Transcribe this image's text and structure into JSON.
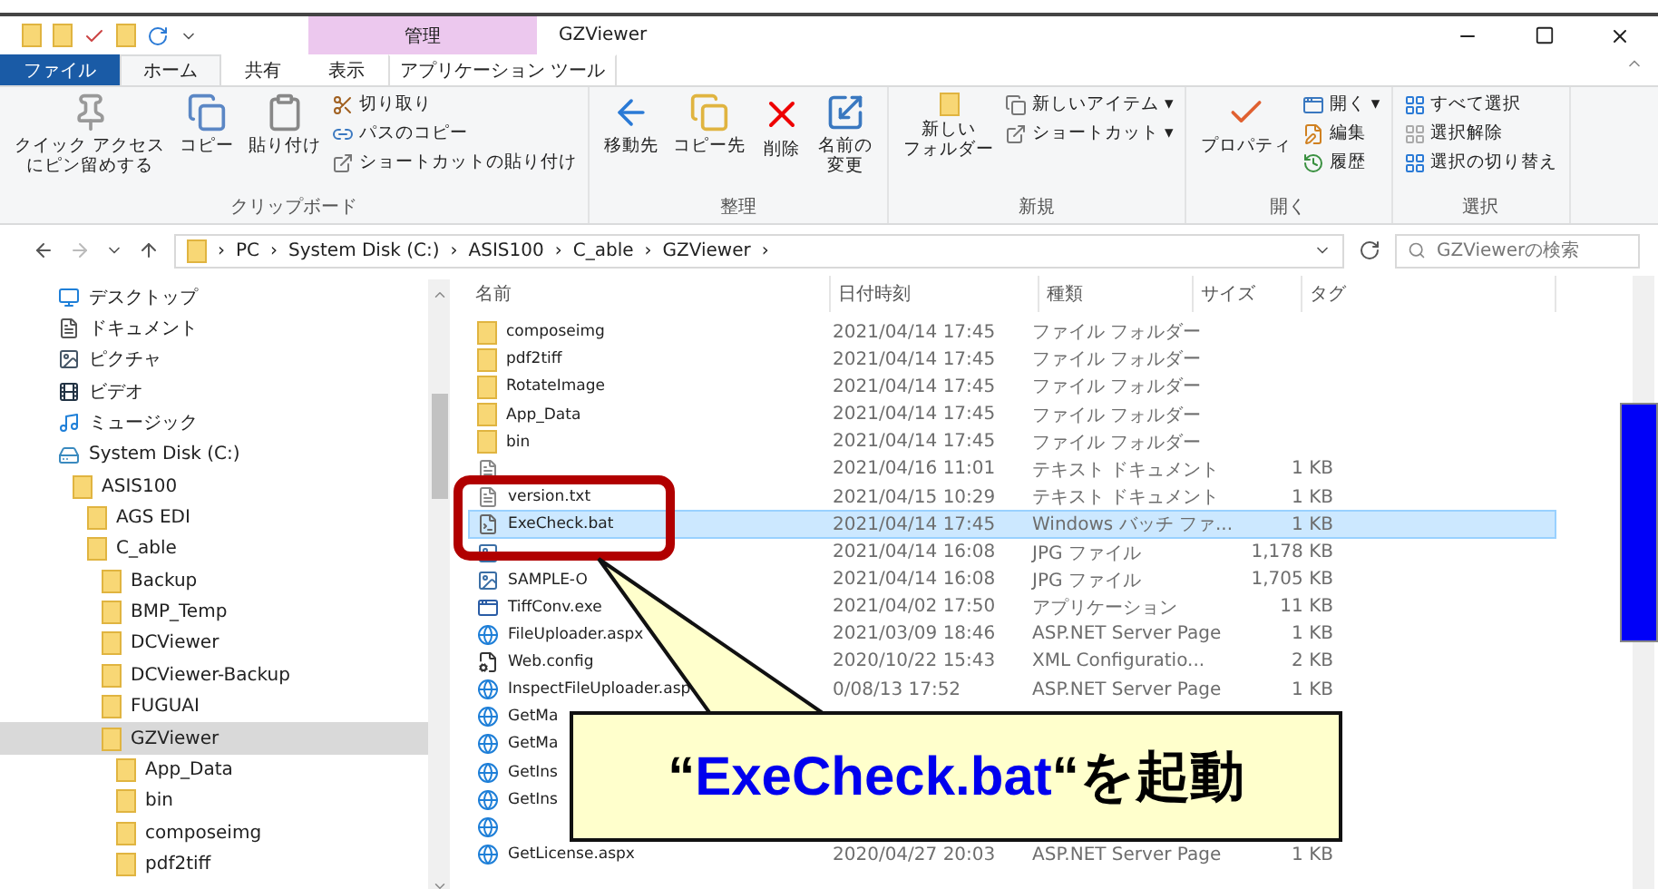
{
  "window": {
    "title": "GZViewer",
    "context_tab": "管理"
  },
  "ribbon_tabs": [
    {
      "label": "ファイル",
      "kind": "file",
      "selected": false
    },
    {
      "label": "ホーム",
      "kind": "tab",
      "selected": true
    },
    {
      "label": "共有",
      "kind": "tab",
      "selected": false
    },
    {
      "label": "表示",
      "kind": "tab",
      "selected": false
    },
    {
      "label": "アプリケーション ツール",
      "kind": "context",
      "selected": false
    }
  ],
  "ribbon_groups": [
    {
      "label": "クリップボード",
      "large": [
        [
          "クイック アクセス",
          "にピン留めする"
        ],
        [
          "コピー"
        ],
        [
          "貼り付け"
        ]
      ],
      "small": [
        "切り取り",
        "パスのコピー",
        "ショートカットの貼り付け"
      ]
    },
    {
      "label": "整理",
      "large": [
        [
          "移動先"
        ],
        [
          "コピー先"
        ],
        [
          "削除"
        ],
        [
          "名前の",
          "変更"
        ]
      ]
    },
    {
      "label": "新規",
      "large": [
        [
          "新しい",
          "フォルダー"
        ]
      ],
      "small": [
        "新しいアイテム ▾",
        "ショートカット ▾"
      ]
    },
    {
      "label": "開く",
      "large": [
        [
          "プロパティ"
        ]
      ],
      "small": [
        "開く ▾",
        "編集",
        "履歴"
      ]
    },
    {
      "label": "選択",
      "small": [
        "すべて選択",
        "選択解除",
        "選択の切り替え"
      ]
    }
  ],
  "address": {
    "separator": "›",
    "crumbs": [
      "PC",
      "System Disk (C:)",
      "ASIS100",
      "C_able",
      "GZViewer"
    ],
    "search_placeholder": "GZViewerの検索"
  },
  "nav_tree": [
    {
      "label": "デスクトップ",
      "kind": "desktop",
      "selected": false
    },
    {
      "label": "ドキュメント",
      "kind": "document",
      "selected": false
    },
    {
      "label": "ピクチャ",
      "kind": "picture",
      "selected": false
    },
    {
      "label": "ビデオ",
      "kind": "video",
      "selected": false
    },
    {
      "label": "ミュージック",
      "kind": "music",
      "selected": false
    },
    {
      "label": "System Disk (C:)",
      "kind": "disk",
      "selected": false,
      "children": [
        {
          "label": "ASIS100",
          "kind": "folder",
          "selected": false,
          "children": [
            {
              "label": "AGS EDI",
              "kind": "folder",
              "selected": false
            },
            {
              "label": "C_able",
              "kind": "folder",
              "selected": false,
              "children": [
                {
                  "label": "Backup",
                  "kind": "folder",
                  "selected": false
                },
                {
                  "label": "BMP_Temp",
                  "kind": "folder",
                  "selected": false
                },
                {
                  "label": "DCViewer",
                  "kind": "folder",
                  "selected": false
                },
                {
                  "label": "DCViewer-Backup",
                  "kind": "folder",
                  "selected": false
                },
                {
                  "label": "FUGUAI",
                  "kind": "folder",
                  "selected": false
                },
                {
                  "label": "GZViewer",
                  "kind": "folder",
                  "selected": true,
                  "children": [
                    {
                      "label": "App_Data",
                      "kind": "folder",
                      "selected": false
                    },
                    {
                      "label": "bin",
                      "kind": "folder",
                      "selected": false
                    },
                    {
                      "label": "composeimg",
                      "kind": "folder",
                      "selected": false
                    },
                    {
                      "label": "pdf2tiff",
                      "kind": "folder",
                      "selected": false
                    }
                  ]
                }
              ]
            }
          ]
        }
      ]
    }
  ],
  "columns": [
    "名前",
    "日付時刻",
    "種類",
    "サイズ",
    "タグ"
  ],
  "files": [
    {
      "kind": "folder",
      "name": "composeimg",
      "date": "2021/04/14 17:45",
      "type": "ファイル フォルダー",
      "selected": false
    },
    {
      "kind": "folder",
      "name": "pdf2tiff",
      "date": "2021/04/14 17:45",
      "type": "ファイル フォルダー",
      "selected": false
    },
    {
      "kind": "folder",
      "name": "RotateImage",
      "date": "2021/04/14 17:45",
      "type": "ファイル フォルダー",
      "selected": false
    },
    {
      "kind": "folder",
      "name": "App_Data",
      "date": "2021/04/14 17:45",
      "type": "ファイル フォルダー",
      "selected": false
    },
    {
      "kind": "folder",
      "name": "bin",
      "date": "2021/04/14 17:45",
      "type": "ファイル フォルダー",
      "selected": false
    },
    {
      "kind": "text",
      "date": "2021/04/16 11:01",
      "type": "テキスト ドキュメント",
      "size": "1 KB",
      "selected": false
    },
    {
      "kind": "text",
      "name": "version.txt",
      "date": "2021/04/15 10:29",
      "type": "テキスト ドキュメント",
      "size": "1 KB",
      "selected": false
    },
    {
      "kind": "batch",
      "name": "ExeCheck.bat",
      "date": "2021/04/14 17:45",
      "type": "Windows バッチ ファ...",
      "size": "1 KB",
      "selected": true
    },
    {
      "kind": "image",
      "date": "2021/04/14 16:08",
      "type": "JPG ファイル",
      "size": "1,178 KB",
      "selected": false
    },
    {
      "kind": "image",
      "name": "SAMPLE-O",
      "date": "2021/04/14 16:08",
      "type": "JPG ファイル",
      "size": "1,705 KB",
      "selected": false
    },
    {
      "kind": "app",
      "name": "TiffConv.exe",
      "date": "2021/04/02 17:50",
      "type": "アプリケーション",
      "size": "11 KB",
      "selected": false
    },
    {
      "kind": "web",
      "name": "FileUploader.aspx",
      "date": "2021/03/09 18:46",
      "type": "ASP.NET Server Page",
      "size": "1 KB",
      "selected": false
    },
    {
      "kind": "config",
      "name": "Web.config",
      "date": "2020/10/22 15:43",
      "type": "XML Configuratio...",
      "size": "2 KB",
      "selected": false
    },
    {
      "kind": "web",
      "name": "InspectFileUploader.asp",
      "date": "0/08/13 17:52",
      "type": "ASP.NET Server Page",
      "size": "1 KB",
      "selected": false
    },
    {
      "kind": "web",
      "name": "GetMa",
      "selected": false
    },
    {
      "kind": "web",
      "name": "GetMa",
      "selected": false
    },
    {
      "kind": "web",
      "name": "GetIns",
      "selected": false
    },
    {
      "kind": "web",
      "name": "GetIns",
      "selected": false
    },
    {
      "kind": "web",
      "selected": false
    },
    {
      "kind": "web",
      "name": "GetLicense.aspx",
      "date": "2020/04/27 20:03",
      "type": "ASP.NET Server Page",
      "size": "1 KB",
      "selected": false
    }
  ],
  "callout": {
    "parts": [
      {
        "text": "“",
        "color": "#000000"
      },
      {
        "text": "ExeCheck.bat",
        "color": "#0000ee"
      },
      {
        "text": "“を起動",
        "color": "#000000"
      }
    ]
  }
}
